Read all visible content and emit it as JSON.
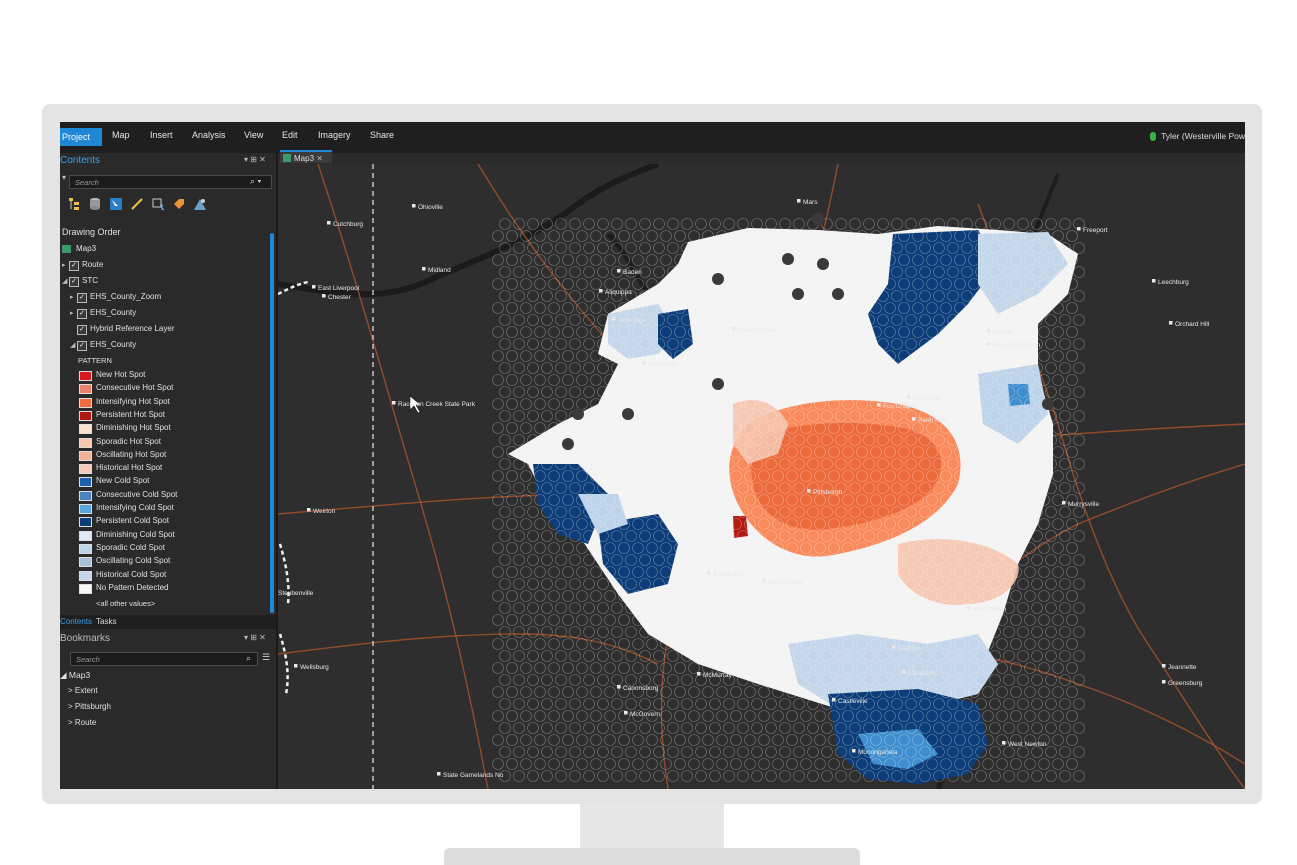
{
  "ribbon": {
    "tabs": [
      "Project",
      "Map",
      "Insert",
      "Analysis",
      "View",
      "Edit",
      "Imagery",
      "Share"
    ],
    "user": "Tyler (Westerville Pow"
  },
  "contents": {
    "title": "Contents",
    "search_placeholder": "Search",
    "drawing_order": "Drawing Order",
    "map_name": "Map3",
    "layers": {
      "route": "Route",
      "stc": "STC",
      "zoom": "EHS_County_Zoom",
      "county1": "EHS_County",
      "hybrid": "Hybrid Reference Layer",
      "county2": "EHS_County"
    },
    "pattern": "PATTERN",
    "other_values": "<all other values>",
    "bottom_tabs": [
      "Contents",
      "Tasks"
    ]
  },
  "legend": [
    {
      "label": "New Hot Spot",
      "color": "#d7191c"
    },
    {
      "label": "Consecutive Hot Spot",
      "color": "#e8826a"
    },
    {
      "label": "Intensifying Hot Spot",
      "color": "#f26a3e"
    },
    {
      "label": "Persistent Hot Spot",
      "color": "#b2180f"
    },
    {
      "label": "Diminishing Hot Spot",
      "color": "#fbe2cf"
    },
    {
      "label": "Sporadic Hot Spot",
      "color": "#f8c6ac"
    },
    {
      "label": "Oscillating Hot Spot",
      "color": "#f2b39b"
    },
    {
      "label": "Historical Hot Spot",
      "color": "#f4c9b8"
    },
    {
      "label": "New Cold Spot",
      "color": "#1f5fb0"
    },
    {
      "label": "Consecutive Cold Spot",
      "color": "#4a84bf"
    },
    {
      "label": "Intensifying Cold Spot",
      "color": "#5aa6da"
    },
    {
      "label": "Persistent Cold Spot",
      "color": "#0c3d78"
    },
    {
      "label": "Diminishing Cold Spot",
      "color": "#dde9f4"
    },
    {
      "label": "Sporadic Cold Spot",
      "color": "#bcd3ea"
    },
    {
      "label": "Oscillating Cold Spot",
      "color": "#a9bfd6"
    },
    {
      "label": "Historical Cold Spot",
      "color": "#c4d6ea"
    },
    {
      "label": "No Pattern Detected",
      "color": "#f7f7f7"
    }
  ],
  "bookmarks": {
    "title": "Bookmarks",
    "search_placeholder": "Search",
    "map": "Map3",
    "items": [
      "Extent",
      "Pittsburgh",
      "Route"
    ]
  },
  "map": {
    "tab": "Map3",
    "places": [
      "Ohioville",
      "Cutchburg",
      "Midland",
      "East Liverpool",
      "Chester",
      "Baden",
      "Aliquippa",
      "Mars",
      "Freeport",
      "Leechburg",
      "Ambridge",
      "Franklin Park",
      "Orchard Hill",
      "Arnold",
      "New Kensington",
      "Coraopolis",
      "Oakmont",
      "Fox Chapel",
      "Penn Hills",
      "Raccoon Creek State Park",
      "Pittsburgh",
      "Weirton",
      "Murrysville",
      "Bridgeville",
      "McKeesport",
      "West Mifflin",
      "Steubenville",
      "Jeannette",
      "Wellsburg",
      "Clairton",
      "Elizabeth",
      "Greensburg",
      "Canonsburg",
      "McMurray",
      "Castleville",
      "McGovern",
      "Monongahela",
      "West Newton",
      "State Gamelands No"
    ]
  }
}
